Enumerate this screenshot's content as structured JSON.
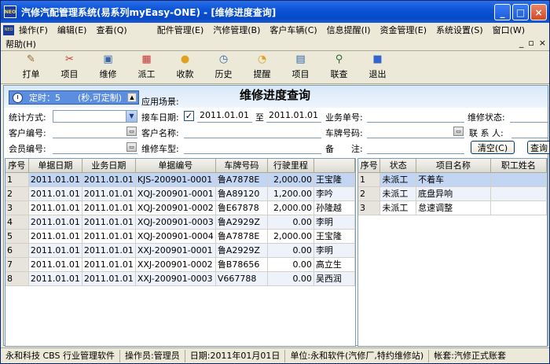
{
  "window": {
    "title": "汽修汽配管理系统(易系列myEasy-ONE) - [维修进度查询]",
    "logo_text": "NEO",
    "controls": [
      "_",
      "□",
      "×"
    ]
  },
  "menu": {
    "items": [
      "操作(F)",
      "编辑(E)",
      "查看(Q)",
      "配件管理(E)",
      "汽修管理(B)",
      "客户车辆(C)",
      "信息提醒(I)",
      "资金管理(E)",
      "系统设置(S)",
      "窗口(W)"
    ],
    "help": "帮助(H)",
    "mdi_controls": [
      "_",
      "▫",
      "×"
    ]
  },
  "toolbar": {
    "items": [
      {
        "label": "打单",
        "icon": "pencil-doc-icon",
        "glyph": "✎",
        "color": "#996633"
      },
      {
        "label": "项目",
        "icon": "tools-icon",
        "glyph": "✂",
        "color": "#cc3333"
      },
      {
        "label": "维修",
        "icon": "monitor-icon",
        "glyph": "▣",
        "color": "#3366aa"
      },
      {
        "label": "派工",
        "icon": "calendar-icon",
        "glyph": "▦",
        "color": "#cc3333"
      },
      {
        "label": "收款",
        "icon": "coins-icon",
        "glyph": "●",
        "color": "#e0a020"
      },
      {
        "label": "历史",
        "icon": "clock-icon",
        "glyph": "◷",
        "color": "#3366aa"
      },
      {
        "label": "提醒",
        "icon": "speech-bubble-icon",
        "glyph": "◔",
        "color": "#e0a020"
      },
      {
        "label": "项目",
        "icon": "clipboard-icon",
        "glyph": "▤",
        "color": "#3366aa"
      },
      {
        "label": "联查",
        "icon": "magnifier-icon",
        "glyph": "⚲",
        "color": "#336633"
      },
      {
        "label": "退出",
        "icon": "exit-icon",
        "glyph": "■",
        "color": "#3366cc"
      }
    ]
  },
  "header": {
    "timer_label": "定时：5",
    "timer_note": "(秒,可定制)",
    "scene_label": "应用场景:",
    "form_title": "维修进度查询"
  },
  "form": {
    "stat_method_label": "统计方式:",
    "receive_date_label": "接车日期:",
    "receive_date_checked": "✓",
    "date_from": "2011.01.01",
    "date_to_label": "至",
    "date_to": "2011.01.01",
    "business_no_label": "业务单号:",
    "repair_status_label": "维修状态:",
    "customer_no_label": "客户编号:",
    "customer_name_label": "客户名称:",
    "plate_no_label": "车牌号码:",
    "contact_label": "联 系 人:",
    "member_no_label": "会员编号:",
    "car_model_label": "维修车型:",
    "remark_label": "备　　注:",
    "clear_button": "清空(C)",
    "query_button": "查询"
  },
  "left_grid": {
    "columns": [
      "序号",
      "单据日期",
      "业务日期",
      "单据编号",
      "车牌号码",
      "行驶里程",
      ""
    ],
    "rows": [
      [
        "1",
        "2011.01.01",
        "2011.01.01",
        "KJS-200901-0001",
        "鲁A7878E",
        "2,000.00",
        "王宝隆"
      ],
      [
        "2",
        "2011.01.01",
        "2011.01.01",
        "XQJ-200901-0001",
        "鲁A89120",
        "1,200.00",
        "李吟"
      ],
      [
        "3",
        "2011.01.01",
        "2011.01.01",
        "XQJ-200901-0002",
        "鲁E67878",
        "2,000.00",
        "孙隆越"
      ],
      [
        "4",
        "2011.01.01",
        "2011.01.01",
        "XQJ-200901-0003",
        "鲁A2929Z",
        "0.00",
        "李明"
      ],
      [
        "5",
        "2011.01.01",
        "2011.01.01",
        "XQJ-200901-0004",
        "鲁A7878E",
        "2,000.00",
        "王宝隆"
      ],
      [
        "6",
        "2011.01.01",
        "2011.01.01",
        "XXJ-200901-0001",
        "鲁A2929Z",
        "0.00",
        "李明"
      ],
      [
        "7",
        "2011.01.01",
        "2011.01.01",
        "XXJ-200901-0002",
        "鲁B78656",
        "0.00",
        "高立生"
      ],
      [
        "8",
        "2011.01.01",
        "2011.01.01",
        "XXJ-200901-0003",
        "V667788",
        "0.00",
        "吴西润"
      ]
    ]
  },
  "right_grid": {
    "columns": [
      "序号",
      "状态",
      "项目名称",
      "职工姓名"
    ],
    "rows": [
      [
        "1",
        "未派工",
        "不着车",
        ""
      ],
      [
        "2",
        "未派工",
        "底盘异响",
        ""
      ],
      [
        "3",
        "未派工",
        "怠速调整",
        ""
      ]
    ]
  },
  "status": {
    "software": "永和科技 CBS 行业管理软件",
    "operator": "操作员:管理员",
    "date": "日期:2011年01月01日",
    "unit": "单位:永和软件(汽修厂,特约维修站)",
    "account": "帐套:汽修正式账套"
  }
}
